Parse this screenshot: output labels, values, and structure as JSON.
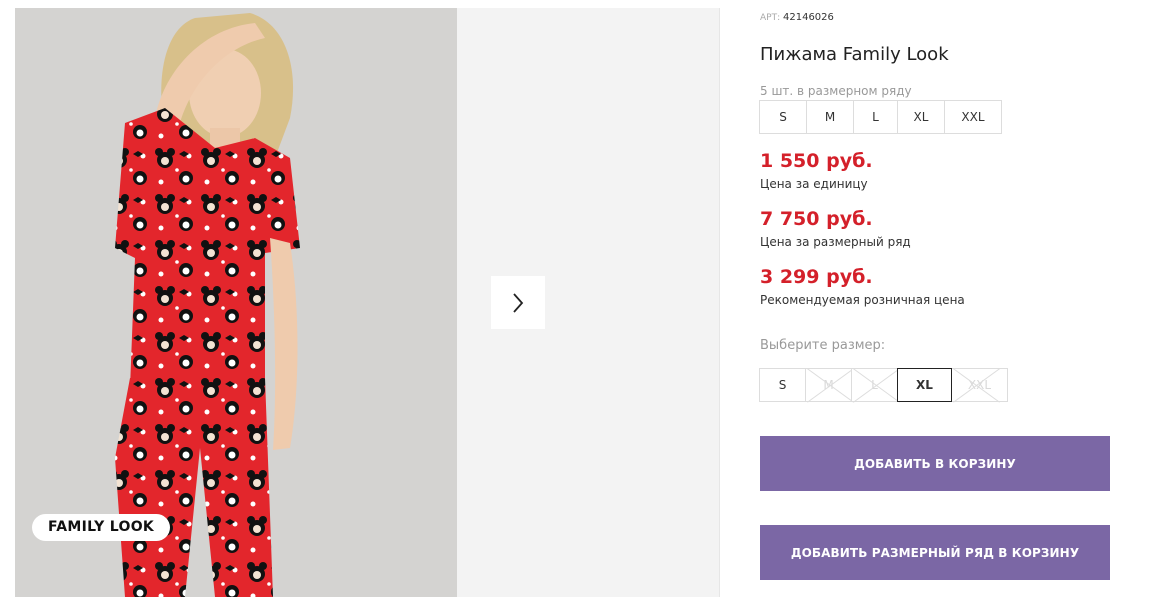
{
  "gallery": {
    "badge": "FAMILY LOOK",
    "next_icon": "chevron-right-icon"
  },
  "product": {
    "art_label": "АРТ:",
    "art_number": "42146026",
    "title": "Пижама Family Look",
    "size_row_note": "5 шт. в размерном ряду",
    "size_row": [
      "S",
      "M",
      "L",
      "XL",
      "XXL"
    ],
    "prices": [
      {
        "value": "1 550 руб.",
        "label": "Цена за единицу"
      },
      {
        "value": "7 750 руб.",
        "label": "Цена за размерный ряд"
      },
      {
        "value": "3 299 руб.",
        "label": "Рекомендуемая розничная цена"
      }
    ],
    "price_color": "#d4202a",
    "choose_size_label": "Выберите размер:",
    "size_options": [
      {
        "label": "S",
        "state": "available"
      },
      {
        "label": "M",
        "state": "unavailable"
      },
      {
        "label": "L",
        "state": "unavailable"
      },
      {
        "label": "XL",
        "state": "selected"
      },
      {
        "label": "XXL",
        "state": "unavailable"
      }
    ],
    "add_to_cart_label": "ДОБАВИТЬ В КОРЗИНУ",
    "add_row_to_cart_label": "ДОБАВИТЬ РАЗМЕРНЫЙ РЯД В КОРЗИНУ",
    "button_color": "#7b67a5"
  }
}
